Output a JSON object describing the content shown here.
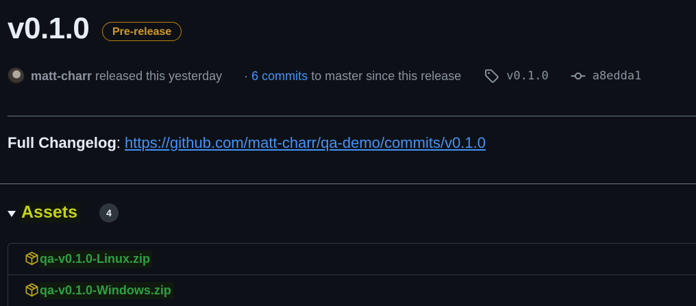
{
  "release": {
    "title": "v0.1.0",
    "badge": "Pre-release"
  },
  "meta": {
    "author": "matt-charr",
    "author_suffix": "released this yesterday",
    "commits_prefix": "·",
    "commits_link": "6 commits",
    "commits_suffix": "to master since this release",
    "tag": "v0.1.0",
    "commit_sha": "a8edda1"
  },
  "changelog": {
    "label": "Full Changelog",
    "separator": ":",
    "url": "https://github.com/matt-charr/qa-demo/commits/v0.1.0"
  },
  "assets": {
    "title": "Assets",
    "count": "4",
    "items": [
      {
        "name": "qa-v0.1.0-Linux.zip",
        "icon": "package-icon"
      },
      {
        "name": "qa-v0.1.0-Windows.zip",
        "icon": "package-icon"
      }
    ]
  },
  "colors": {
    "background": "#0d1117",
    "badge_accent": "#d29922",
    "link": "#4493f8",
    "asset_link": "#2ea043",
    "assets_title": "#c5d317"
  }
}
